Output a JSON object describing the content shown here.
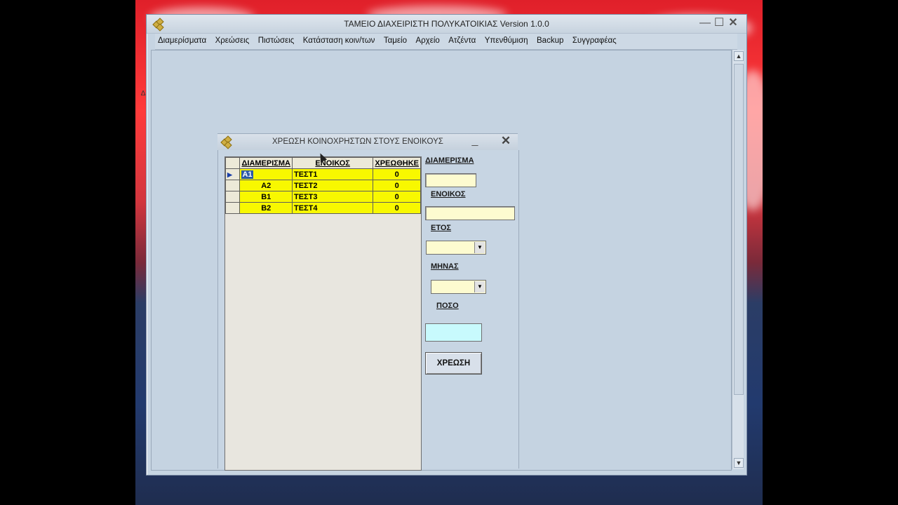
{
  "main_window": {
    "title": "ΤΑΜΕΙΟ ΔΙΑΧΕΙΡΙΣΤΗ ΠΟΛΥΚΑΤΟΙΚΙΑΣ Version 1.0.0",
    "menu": [
      "Διαμερίσματα",
      "Χρεώσεις",
      "Πιστώσεις",
      "Κατάσταση κοιν/των",
      "Ταμείο",
      "Αρχείο",
      "Ατζέντα",
      "Υπενθύμιση",
      "Backup",
      "Συγγραφέας"
    ]
  },
  "dialog": {
    "title": "ΧΡΕΩΣΗ ΚΟΙΝΟΧΡΗΣΤΩΝ ΣΤΟΥΣ ΕΝΟΙΚΟΥΣ",
    "grid": {
      "headers": [
        "ΔΙΑΜΕΡΙΣΜΑ",
        "ΕΝΟΙΚΟΣ",
        "ΧΡΕΩΘΗΚΕ"
      ],
      "rows": [
        {
          "apartment": "A1",
          "tenant": "ΤΕΣΤ1",
          "charged": "0"
        },
        {
          "apartment": "A2",
          "tenant": "ΤΕΣΤ2",
          "charged": "0"
        },
        {
          "apartment": "B1",
          "tenant": "ΤΕΣΤ3",
          "charged": "0"
        },
        {
          "apartment": "B2",
          "tenant": "ΤΕΣΤ4",
          "charged": "0"
        }
      ]
    },
    "form": {
      "apartment_label": "ΔΙΑΜΕΡΙΣΜΑ",
      "tenant_label": "ΕΝΟΙΚΟΣ",
      "year_label": "ΕΤΟΣ",
      "month_label": "ΜΗΝΑΣ",
      "amount_label": "ΠΟΣΟ",
      "apartment_value": "",
      "tenant_value": "",
      "year_value": "",
      "month_value": "",
      "amount_value": "",
      "charge_button": "ΧΡΕΩΣΗ"
    }
  },
  "colors": {
    "grid_row": "#f8f800",
    "input_bg": "#fdfbd0",
    "amount_bg": "#c8fafd",
    "window_bg": "#c6d4e2"
  }
}
